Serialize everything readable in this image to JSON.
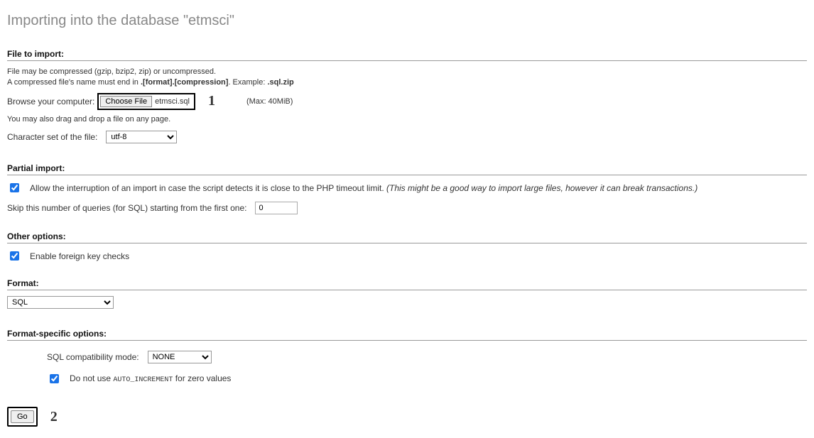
{
  "page": {
    "title": "Importing into the database \"etmsci\""
  },
  "file_section": {
    "heading": "File to import:",
    "note1": "File may be compressed (gzip, bzip2, zip) or uncompressed.",
    "note2a": "A compressed file's name must end in ",
    "note2b": ".[format].[compression]",
    "note2c": ". Example: ",
    "note2d": ".sql.zip",
    "browse_label": "Browse your computer:",
    "choose_btn": "Choose File",
    "chosen_file": "etmsci.sql",
    "marker1": "1",
    "max_size": "(Max: 40MiB)",
    "drag_note": "You may also drag and drop a file on any page.",
    "charset_label": "Character set of the file:",
    "charset_value": "utf-8"
  },
  "partial": {
    "heading": "Partial import:",
    "allow_label": "Allow the interruption of an import in case the script detects it is close to the PHP timeout limit. ",
    "allow_hint": "(This might be a good way to import large files, however it can break transactions.)",
    "skip_label": "Skip this number of queries (for SQL) starting from the first one:",
    "skip_value": "0"
  },
  "other": {
    "heading": "Other options:",
    "fk_label": "Enable foreign key checks"
  },
  "format": {
    "heading": "Format:",
    "value": "SQL"
  },
  "fso": {
    "heading": "Format-specific options:",
    "compat_label": "SQL compatibility mode:",
    "compat_value": "NONE",
    "noauto_a": "Do not use ",
    "noauto_code": "AUTO_INCREMENT",
    "noauto_b": " for zero values"
  },
  "footer": {
    "go": "Go",
    "marker2": "2"
  }
}
